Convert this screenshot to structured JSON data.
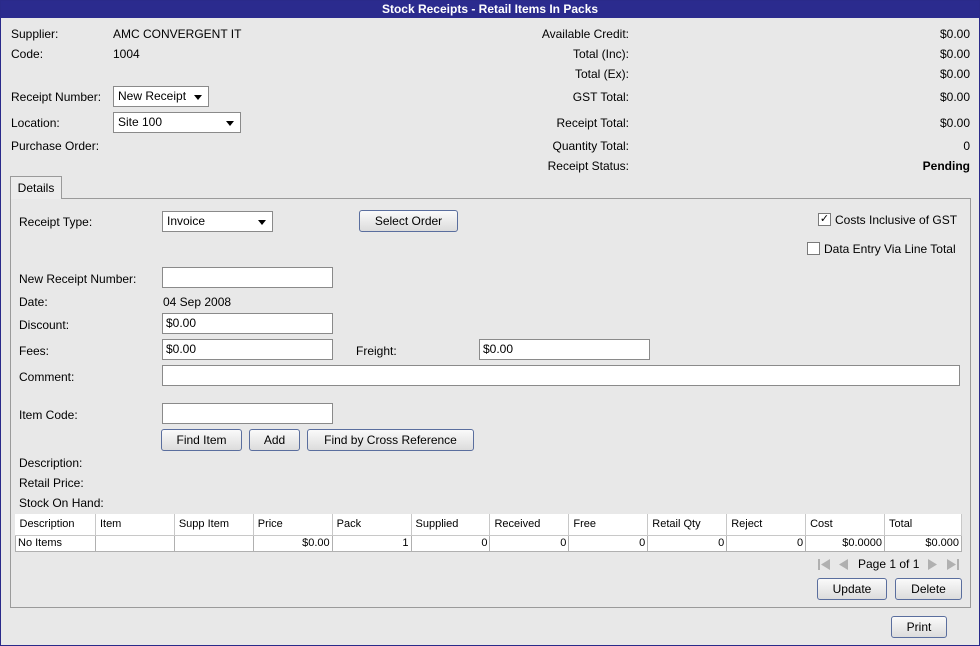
{
  "window": {
    "title": "Stock Receipts  - Retail Items In Packs"
  },
  "header": {
    "supplier_label": "Supplier:",
    "supplier_value": "AMC CONVERGENT IT",
    "code_label": "Code:",
    "code_value": "1004",
    "receipt_number_label": "Receipt Number:",
    "receipt_number_value": "New Receipt",
    "location_label": "Location:",
    "location_value": "Site 100",
    "purchase_order_label": "Purchase Order:",
    "available_credit_label": "Available Credit:",
    "available_credit_value": "$0.00",
    "total_inc_label": "Total (Inc):",
    "total_inc_value": "$0.00",
    "total_ex_label": "Total (Ex):",
    "total_ex_value": "$0.00",
    "gst_total_label": "GST Total:",
    "gst_total_value": "$0.00",
    "receipt_total_label": "Receipt Total:",
    "receipt_total_value": "$0.00",
    "quantity_total_label": "Quantity Total:",
    "quantity_total_value": "0",
    "receipt_status_label": "Receipt Status:",
    "receipt_status_value": "Pending"
  },
  "tabs": {
    "details": "Details"
  },
  "details": {
    "receipt_type_label": "Receipt Type:",
    "receipt_type_value": "Invoice",
    "select_order_button": "Select Order",
    "costs_inclusive_gst_label": "Costs Inclusive of GST",
    "costs_inclusive_gst_checked": true,
    "data_entry_line_total_label": "Data Entry Via Line Total",
    "data_entry_line_total_checked": false,
    "new_receipt_number_label": "New Receipt Number:",
    "new_receipt_number_value": "",
    "date_label": "Date:",
    "date_value": "04 Sep 2008",
    "discount_label": "Discount:",
    "discount_value": "$0.00",
    "fees_label": "Fees:",
    "fees_value": "$0.00",
    "freight_label": "Freight:",
    "freight_value": "$0.00",
    "comment_label": "Comment:",
    "comment_value": "",
    "item_code_label": "Item Code:",
    "item_code_value": "",
    "find_item_button": "Find Item",
    "add_button": "Add",
    "find_cross_ref_button": "Find by Cross Reference",
    "description_label": "Description:",
    "retail_price_label": "Retail Price:",
    "stock_on_hand_label": "Stock On Hand:"
  },
  "grid": {
    "columns": [
      "Description",
      "Item",
      "Supp Item",
      "Price",
      "Pack",
      "Supplied",
      "Received",
      "Free",
      "Retail Qty",
      "Reject",
      "Cost",
      "Total"
    ],
    "row": [
      "No Items",
      "",
      "",
      "$0.00",
      "1",
      "0",
      "0",
      "0",
      "0",
      "0",
      "$0.0000",
      "$0.000"
    ]
  },
  "pager": {
    "text": "Page 1 of 1"
  },
  "actions": {
    "update_button": "Update",
    "delete_button": "Delete",
    "print_button": "Print"
  },
  "colors": {
    "titlebar": "#2b2b8e",
    "button_border": "#5a6e9e"
  }
}
